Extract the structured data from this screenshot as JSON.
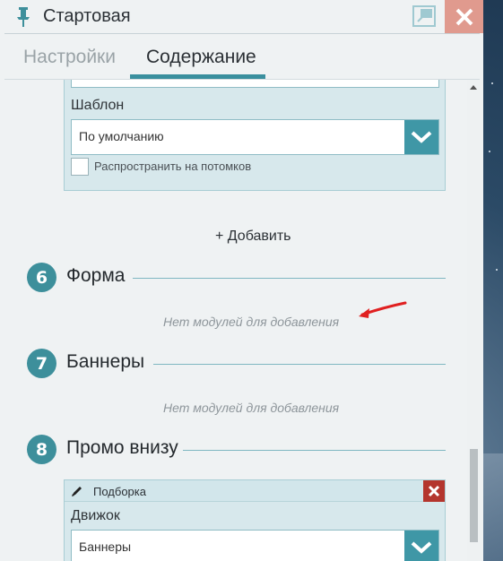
{
  "window": {
    "title": "Стартовая",
    "icons": {
      "pin": "pushpin-icon",
      "popout": "popout-window-icon",
      "close": "close-icon"
    },
    "colors": {
      "accent": "#3d8f9b",
      "close_bg": "#e09a8e",
      "delete_bg": "#b4352d"
    }
  },
  "tabs": [
    {
      "label": "Настройки",
      "active": false
    },
    {
      "label": "Содержание",
      "active": true
    }
  ],
  "template_block": {
    "template_label": "Шаблон",
    "template_value": "По умолчанию",
    "propagate_label": "Распространить на потомков"
  },
  "add_label": "+ Добавить",
  "sections": [
    {
      "number": "6",
      "title": "Форма",
      "empty_text": "Нет модулей для добавления"
    },
    {
      "number": "7",
      "title": "Баннеры",
      "empty_text": "Нет модулей для добавления"
    },
    {
      "number": "8",
      "title": "Промо внизу"
    }
  ],
  "module_block": {
    "title": "Подборка",
    "engine_label": "Движок",
    "engine_value": "Баннеры"
  }
}
